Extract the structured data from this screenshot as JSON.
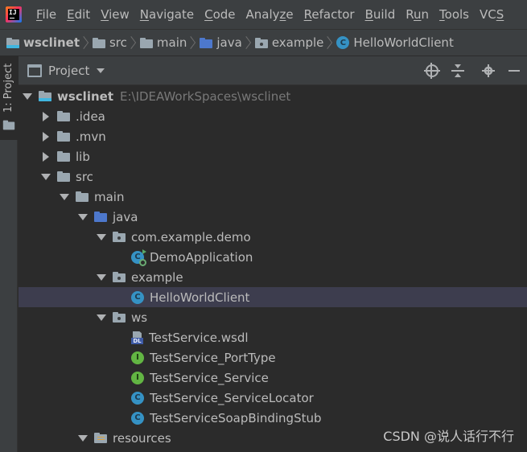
{
  "menubar": {
    "logo": "intellij-logo",
    "items": [
      {
        "mn": "F",
        "rest": "ile"
      },
      {
        "mn": "E",
        "rest": "dit"
      },
      {
        "mn": "V",
        "rest": "iew"
      },
      {
        "mn": "N",
        "rest": "avigate"
      },
      {
        "mn": "C",
        "rest": "ode"
      },
      {
        "pre": "Analy",
        "mn": "z",
        "rest": "e"
      },
      {
        "mn": "R",
        "rest": "efactor"
      },
      {
        "mn": "B",
        "rest": "uild"
      },
      {
        "pre": "R",
        "mn": "u",
        "rest": "n"
      },
      {
        "mn": "T",
        "rest": "ools"
      },
      {
        "pre": "VC",
        "mn": "S",
        "rest": ""
      }
    ]
  },
  "breadcrumb": [
    {
      "label": "wsclinet",
      "icon": "module-folder-icon"
    },
    {
      "label": "src",
      "icon": "folder-icon"
    },
    {
      "label": "main",
      "icon": "folder-icon"
    },
    {
      "label": "java",
      "icon": "source-folder-icon"
    },
    {
      "label": "example",
      "icon": "package-icon"
    },
    {
      "label": "HelloWorldClient",
      "icon": "class-icon"
    }
  ],
  "stripe": {
    "label": "1: Project"
  },
  "toolwindow": {
    "title": "Project",
    "actions": [
      "locate-icon",
      "collapse-all-icon",
      "settings-gear-icon",
      "minimize-icon"
    ]
  },
  "tree": [
    {
      "label": "wsclinet",
      "path": "E:\\IDEAWorkSpaces\\wsclinet",
      "depth": 0,
      "arrow": "expanded",
      "icon": "module",
      "bold": true
    },
    {
      "label": ".idea",
      "depth": 1,
      "arrow": "collapsed",
      "icon": "folder"
    },
    {
      "label": ".mvn",
      "depth": 1,
      "arrow": "collapsed",
      "icon": "folder"
    },
    {
      "label": "lib",
      "depth": 1,
      "arrow": "collapsed",
      "icon": "folder"
    },
    {
      "label": "src",
      "depth": 1,
      "arrow": "expanded",
      "icon": "folder"
    },
    {
      "label": "main",
      "depth": 2,
      "arrow": "expanded",
      "icon": "folder"
    },
    {
      "label": "java",
      "depth": 3,
      "arrow": "expanded",
      "icon": "source"
    },
    {
      "label": "com.example.demo",
      "depth": 4,
      "arrow": "expanded",
      "icon": "package"
    },
    {
      "label": "DemoApplication",
      "depth": 5,
      "arrow": "none",
      "icon": "spring-class"
    },
    {
      "label": "example",
      "depth": 4,
      "arrow": "expanded",
      "icon": "package"
    },
    {
      "label": "HelloWorldClient",
      "depth": 5,
      "arrow": "none",
      "icon": "class",
      "selected": true
    },
    {
      "label": "ws",
      "depth": 4,
      "arrow": "expanded",
      "icon": "package"
    },
    {
      "label": "TestService.wsdl",
      "depth": 5,
      "arrow": "none",
      "icon": "wsdl"
    },
    {
      "label": "TestService_PortType",
      "depth": 5,
      "arrow": "none",
      "icon": "interface"
    },
    {
      "label": "TestService_Service",
      "depth": 5,
      "arrow": "none",
      "icon": "interface"
    },
    {
      "label": "TestService_ServiceLocator",
      "depth": 5,
      "arrow": "none",
      "icon": "class"
    },
    {
      "label": "TestServiceSoapBindingStub",
      "depth": 5,
      "arrow": "none",
      "icon": "class"
    },
    {
      "label": "resources",
      "depth": 3,
      "arrow": "expanded",
      "icon": "resources"
    }
  ],
  "class_glyph": "C",
  "interface_glyph": "I",
  "wsdl_badge": "DL",
  "watermark": "CSDN @说人话行不行"
}
